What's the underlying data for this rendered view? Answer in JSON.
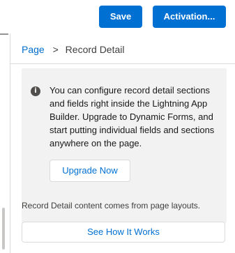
{
  "toolbar": {
    "save_label": "Save",
    "activation_label": "Activation..."
  },
  "breadcrumb": {
    "parent": "Page",
    "separator": ">",
    "current": "Record Detail"
  },
  "info": {
    "icon": "info-icon",
    "icon_glyph": "i",
    "message": "You can configure record detail sections and fields right inside the Lightning App Builder. Upgrade to Dynamic Forms, and start putting individual fields and sections anywhere on the page.",
    "upgrade_label": "Upgrade Now"
  },
  "footnote": "Record Detail content comes from page layouts.",
  "see_how_label": "See How It Works",
  "colors": {
    "brand": "#0070d2",
    "info_background": "#f3f2f2",
    "link": "#006dcc"
  }
}
